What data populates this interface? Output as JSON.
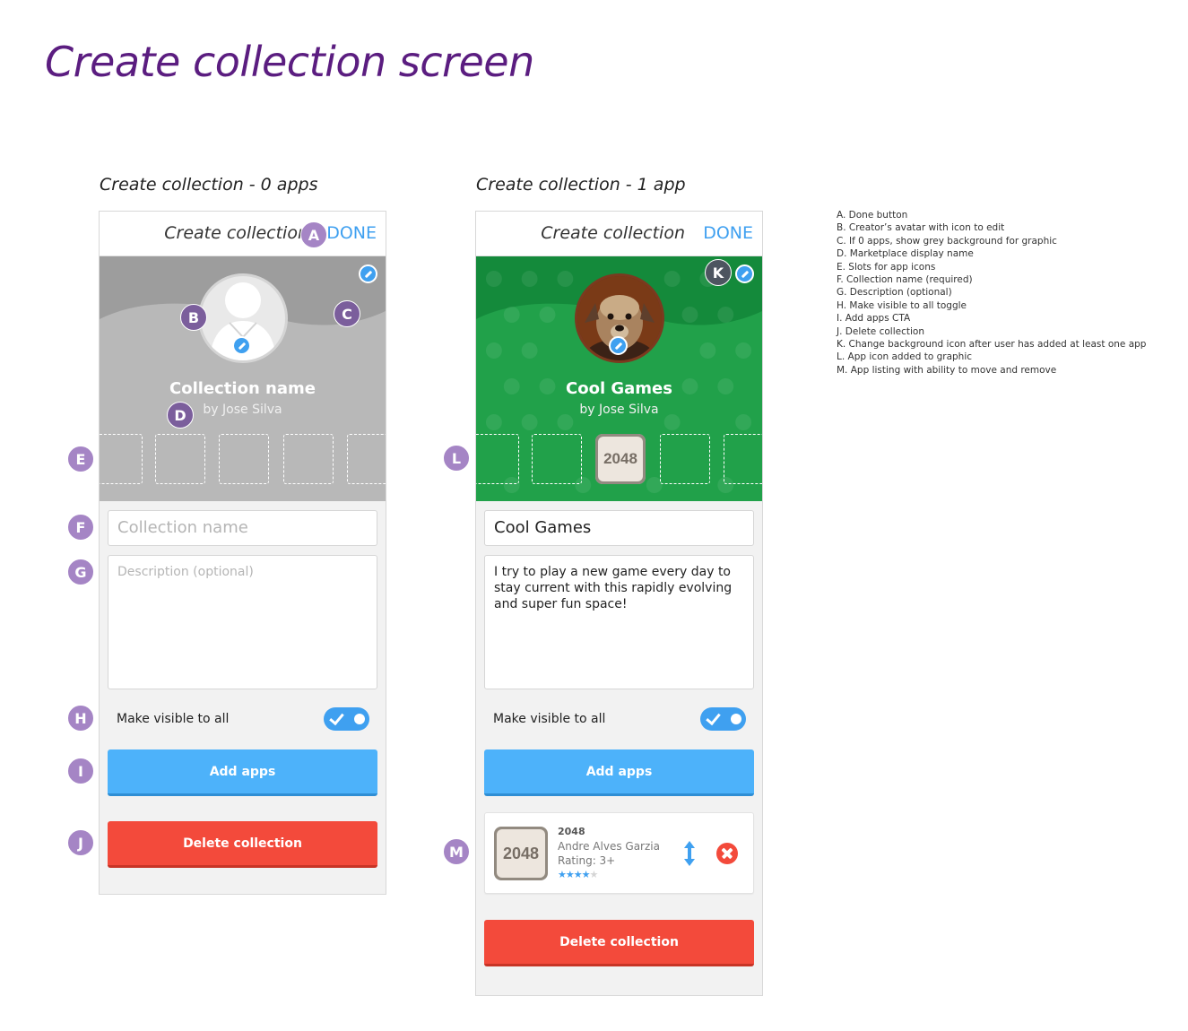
{
  "page_title": "Create collection screen",
  "screens": {
    "left": {
      "caption": "Create collection - 0 apps",
      "header_title": "Create collection",
      "done_label": "DONE",
      "hero_name": "Collection name",
      "hero_author": "by Jose Silva",
      "name_placeholder": "Collection name",
      "desc_placeholder": "Description (optional)",
      "visible_label": "Make visible to all",
      "visible_on": true,
      "add_apps_label": "Add apps",
      "delete_label": "Delete collection",
      "hero_color": "#b8b8b8"
    },
    "right": {
      "caption": "Create collection - 1 app",
      "header_title": "Create collection",
      "done_label": "DONE",
      "hero_name": "Cool Games",
      "hero_author": "by Jose Silva",
      "name_value": "Cool Games",
      "desc_value": "I try to play a new game every day to stay current with this rapidly evolving and super fun space!",
      "slot_app_label": "2048",
      "visible_label": "Make visible to all",
      "visible_on": true,
      "add_apps_label": "Add apps",
      "app": {
        "icon_label": "2048",
        "name": "2048",
        "developer": "Andre Alves Garzia",
        "rating": "Rating: 3+",
        "stars": 4,
        "stars_max": 5
      },
      "delete_label": "Delete collection",
      "hero_color": "#21a14a"
    }
  },
  "callouts": {
    "A": "A",
    "B": "B",
    "C": "C",
    "D": "D",
    "E": "E",
    "F": "F",
    "G": "G",
    "H": "H",
    "I": "I",
    "J": "J",
    "K": "K",
    "L": "L",
    "M": "M"
  },
  "legend": [
    "A. Done button",
    "B. Creator’s avatar with icon to edit",
    "C. If 0 apps, show grey background for graphic",
    "D. Marketplace display name",
    "E. Slots for app icons",
    "F. Collection name (required)",
    "G. Description (optional)",
    "H. Make visible to all toggle",
    "I. Add apps CTA",
    "J. Delete collection",
    "K. Change background icon after user has added at least one app",
    "L. App icon added to graphic",
    "M. App listing with ability to move and remove"
  ],
  "colors": {
    "title_purple": "#5b1d80",
    "accent_blue": "#3fa0f0",
    "cta_blue": "#4db2fa",
    "danger_red": "#f34a3b",
    "callout_purple": "#a585c5"
  }
}
